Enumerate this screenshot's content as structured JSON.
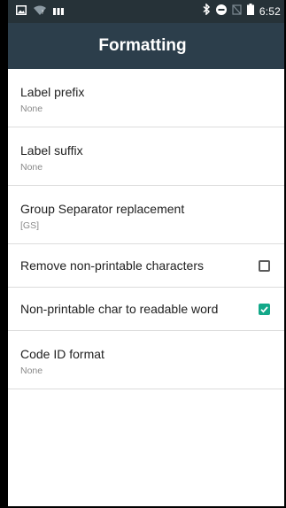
{
  "status_bar": {
    "time": "6:52",
    "icons_left": [
      "image-icon",
      "wifi-question-icon",
      "signal-bars-icon"
    ],
    "icons_right": [
      "bluetooth-icon",
      "do-not-disturb-icon",
      "no-sim-icon",
      "battery-icon"
    ]
  },
  "app_bar": {
    "title": "Formatting"
  },
  "settings": [
    {
      "title": "Label prefix",
      "summary": "None"
    },
    {
      "title": "Label suffix",
      "summary": "None"
    },
    {
      "title": "Group Separator replacement",
      "summary": "[GS]"
    },
    {
      "title": "Remove non-printable characters",
      "checked": false
    },
    {
      "title": "Non-printable char to readable word",
      "checked": true
    },
    {
      "title": "Code ID format",
      "summary": "None"
    }
  ],
  "colors": {
    "status_bar": "#263238",
    "app_bar": "#2c3e4b",
    "accent": "#13a889",
    "divider": "#dcdcdc"
  }
}
